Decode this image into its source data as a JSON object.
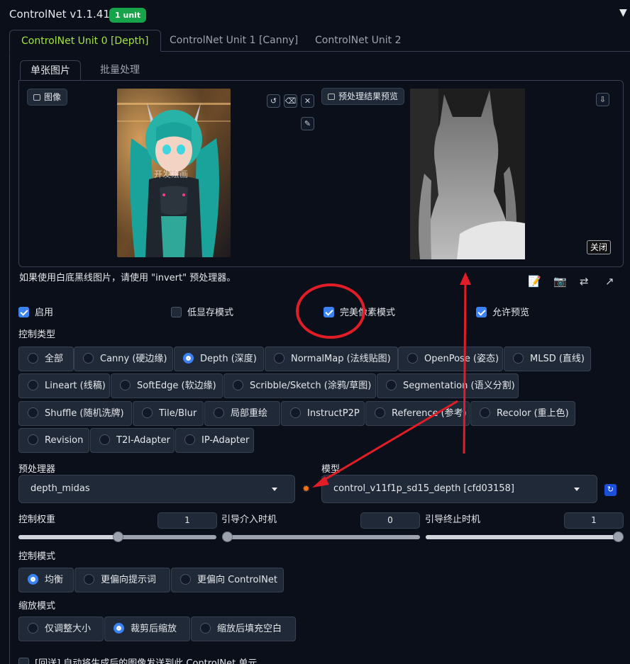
{
  "header": {
    "title": "ControlNet v1.1.410",
    "badge": "1 unit",
    "collapse_glyph": "▼"
  },
  "unit_tabs": [
    {
      "label": "ControlNet Unit 0 [Depth]",
      "active": true
    },
    {
      "label": "ControlNet Unit 1 [Canny]",
      "active": false
    },
    {
      "label": "ControlNet Unit 2",
      "active": false
    }
  ],
  "image_tabs": [
    {
      "label": "单张图片",
      "active": true
    },
    {
      "label": "批量处理",
      "active": false
    }
  ],
  "image_panel": {
    "input_label": "图像",
    "preview_label": "预处理结果预览",
    "close_label": "关闭",
    "watermark": "开发绘画"
  },
  "hint": "如果使用白底黑线图片，请使用 \"invert\" 预处理器。",
  "checkboxes": [
    {
      "label": "启用",
      "checked": true
    },
    {
      "label": "低显存模式",
      "checked": false
    },
    {
      "label": "完美像素模式",
      "checked": true
    },
    {
      "label": "允许预览",
      "checked": true
    }
  ],
  "control_type": {
    "label": "控制类型",
    "options": [
      {
        "label": "全部",
        "selected": false
      },
      {
        "label": "Canny (硬边缘)",
        "selected": false
      },
      {
        "label": "Depth (深度)",
        "selected": true
      },
      {
        "label": "NormalMap (法线贴图)",
        "selected": false
      },
      {
        "label": "OpenPose (姿态)",
        "selected": false
      },
      {
        "label": "MLSD (直线)",
        "selected": false
      },
      {
        "label": "Lineart (线稿)",
        "selected": false
      },
      {
        "label": "SoftEdge (软边缘)",
        "selected": false
      },
      {
        "label": "Scribble/Sketch (涂鸦/草图)",
        "selected": false
      },
      {
        "label": "Segmentation (语义分割)",
        "selected": false
      },
      {
        "label": "Shuffle (随机洗牌)",
        "selected": false
      },
      {
        "label": "Tile/Blur",
        "selected": false
      },
      {
        "label": "局部重绘",
        "selected": false
      },
      {
        "label": "InstructP2P",
        "selected": false
      },
      {
        "label": "Reference (参考)",
        "selected": false
      },
      {
        "label": "Recolor (重上色)",
        "selected": false
      },
      {
        "label": "Revision",
        "selected": false
      },
      {
        "label": "T2I-Adapter",
        "selected": false
      },
      {
        "label": "IP-Adapter",
        "selected": false
      }
    ]
  },
  "preprocessor": {
    "label": "预处理器",
    "value": "depth_midas"
  },
  "model": {
    "label": "模型",
    "value": "control_v11f1p_sd15_depth [cfd03158]"
  },
  "sliders": [
    {
      "label": "控制权重",
      "value": "1",
      "fraction": 0.5
    },
    {
      "label": "引导介入时机",
      "value": "0",
      "fraction": 0.0
    },
    {
      "label": "引导终止时机",
      "value": "1",
      "fraction": 1.0
    }
  ],
  "control_mode": {
    "label": "控制模式",
    "options": [
      {
        "label": "均衡",
        "selected": true
      },
      {
        "label": "更偏向提示词",
        "selected": false
      },
      {
        "label": "更偏向 ControlNet",
        "selected": false
      }
    ]
  },
  "resize_mode": {
    "label": "缩放模式",
    "options": [
      {
        "label": "仅调整大小",
        "selected": false
      },
      {
        "label": "裁剪后缩放",
        "selected": true
      },
      {
        "label": "缩放后填充空白",
        "selected": false
      }
    ]
  },
  "loopback": {
    "label": "[回送] 自动将生成后的图像发送到此 ControlNet 单元",
    "checked": false
  },
  "colors": {
    "accent": "#3b82f6",
    "active_tab": "#a3e635",
    "badge": "#16a34a",
    "annotation": "#e11d27"
  }
}
